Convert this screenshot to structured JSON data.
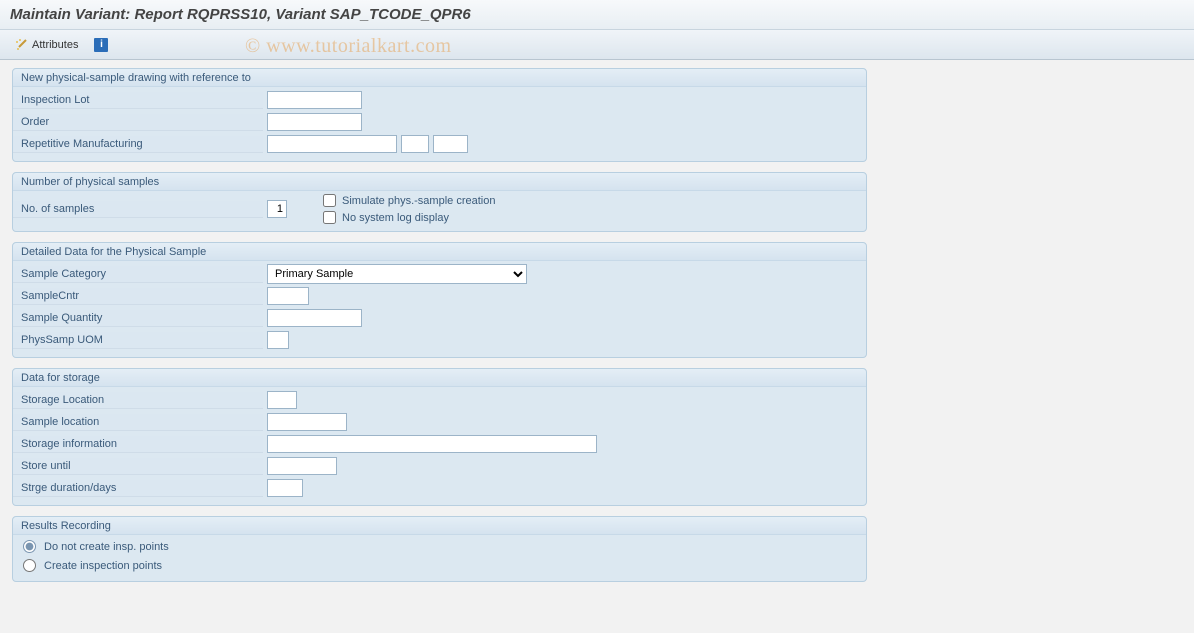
{
  "title": "Maintain Variant: Report RQPRSS10, Variant SAP_TCODE_QPR6",
  "toolbar": {
    "attributes_label": "Attributes"
  },
  "watermark": "© www.tutorialkart.com",
  "group1": {
    "title": "New physical-sample drawing with reference to",
    "inspection_lot_label": "Inspection Lot",
    "order_label": "Order",
    "rep_mfg_label": "Repetitive Manufacturing",
    "inspection_lot_value": "",
    "order_value": "",
    "rep_mfg_v1": "",
    "rep_mfg_v2": "",
    "rep_mfg_v3": ""
  },
  "group2": {
    "title": "Number of physical samples",
    "no_samples_label": "No. of samples",
    "no_samples_value": "1",
    "simulate_label": "Simulate phys.-sample creation",
    "no_syslog_label": "No system log display"
  },
  "group3": {
    "title": "Detailed Data for the Physical Sample",
    "sample_category_label": "Sample Category",
    "sample_category_value": "Primary Sample",
    "sample_cntr_label": "SampleCntr",
    "sample_qty_label": "Sample Quantity",
    "phys_uom_label": "PhysSamp UOM",
    "sample_cntr_value": "",
    "sample_qty_value": "",
    "phys_uom_value": ""
  },
  "group4": {
    "title": "Data for storage",
    "storage_location_label": "Storage Location",
    "sample_location_label": "Sample location",
    "storage_info_label": "Storage information",
    "store_until_label": "Store until",
    "strge_duration_label": "Strge duration/days",
    "storage_location_value": "",
    "sample_location_value": "",
    "storage_info_value": "",
    "store_until_value": "",
    "strge_duration_value": ""
  },
  "group5": {
    "title": "Results Recording",
    "radio1_label": "Do not create insp. points",
    "radio2_label": "Create inspection points"
  }
}
